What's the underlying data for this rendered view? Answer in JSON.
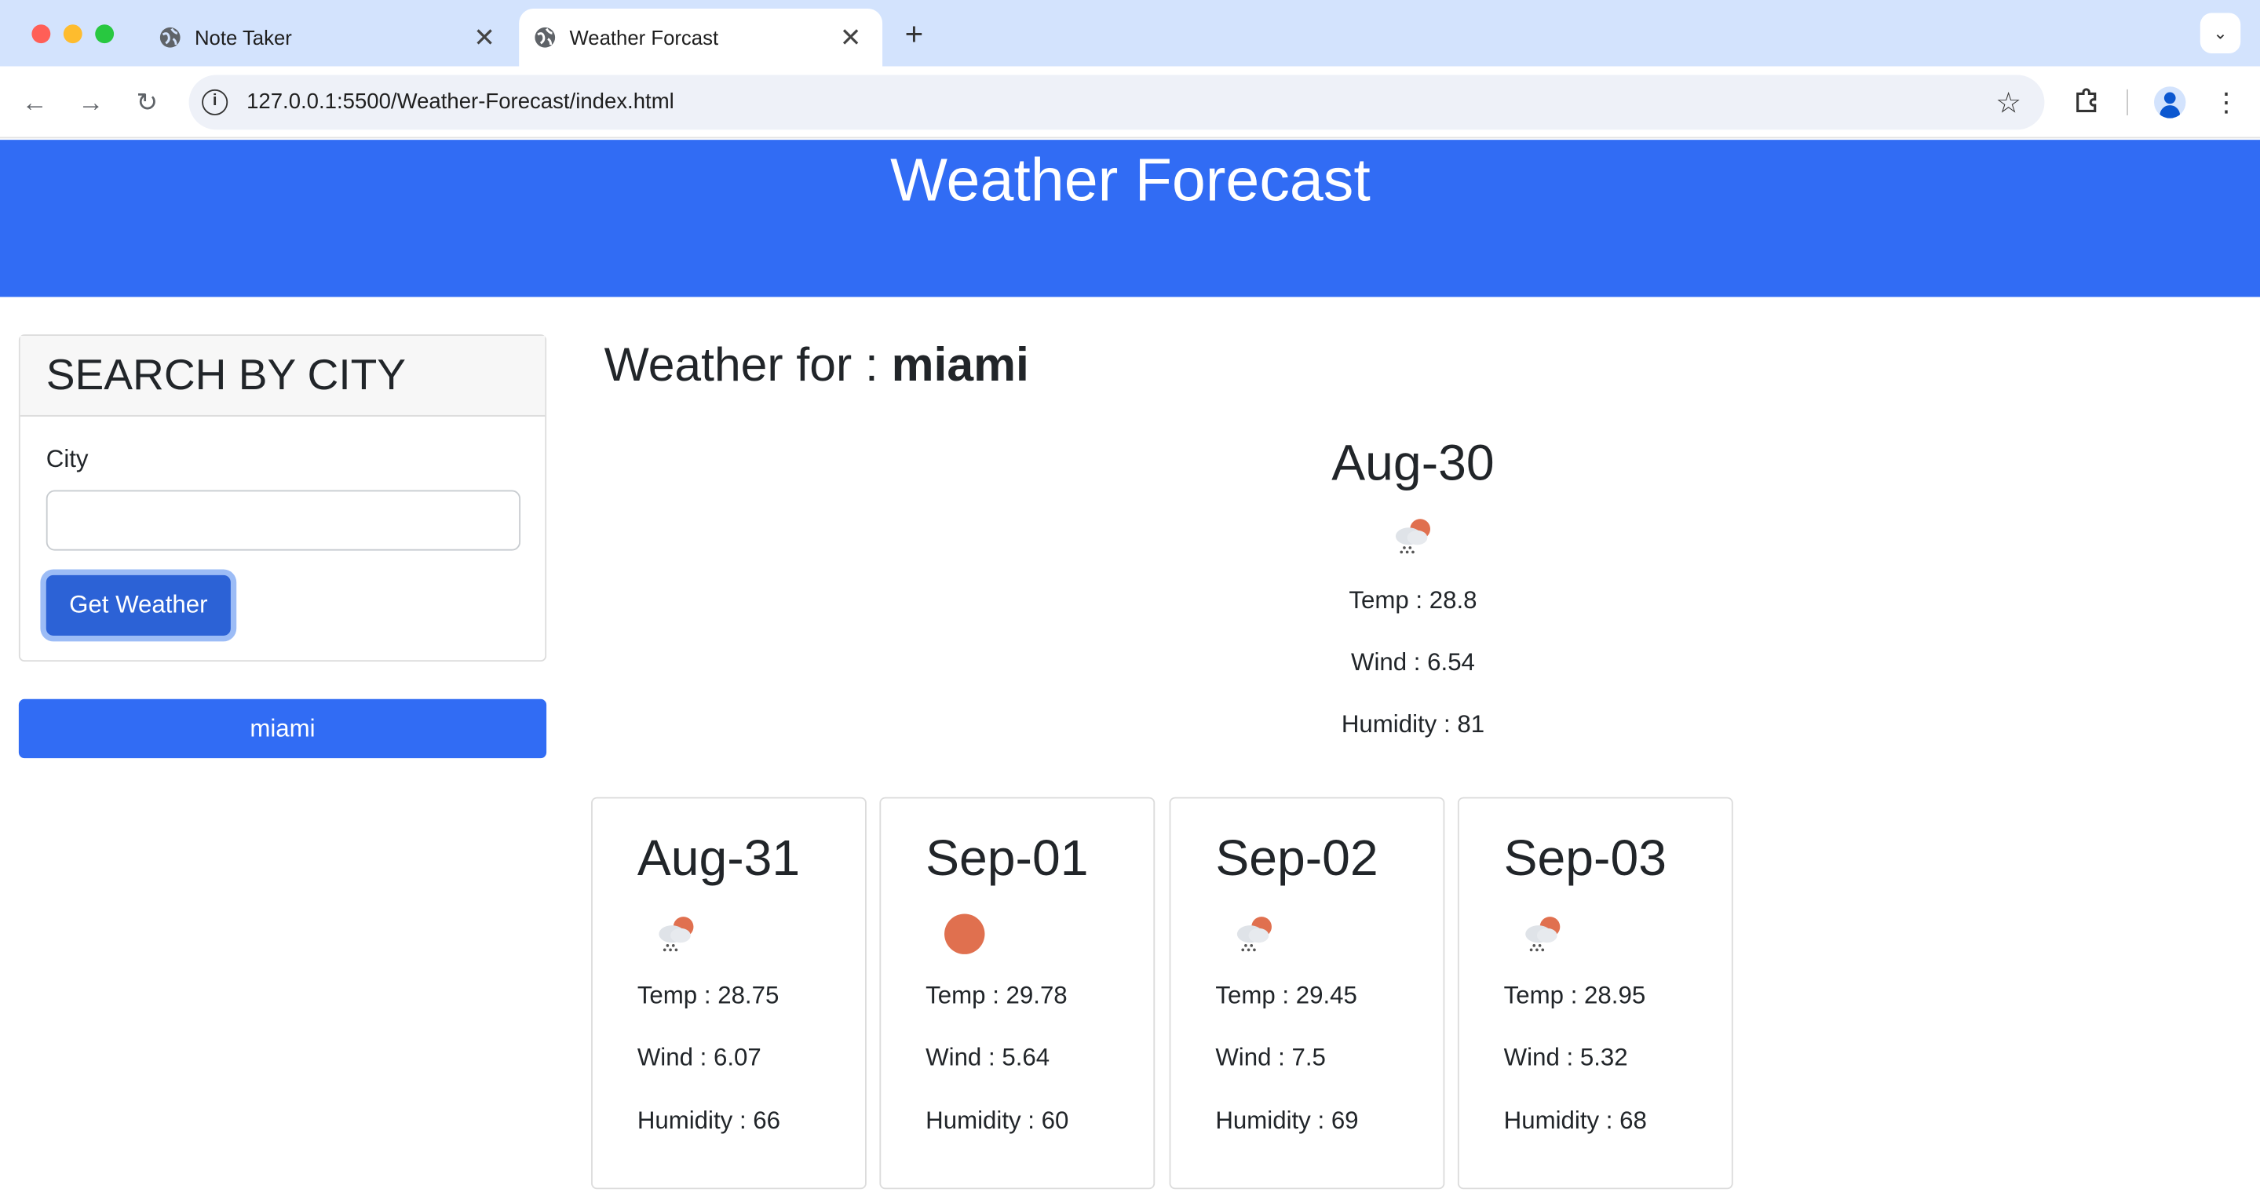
{
  "browser": {
    "tabs": [
      {
        "title": "Note Taker",
        "active": false
      },
      {
        "title": "Weather Forcast",
        "active": true
      }
    ],
    "url": "127.0.0.1:5500/Weather-Forecast/index.html"
  },
  "header": {
    "title": "Weather Forecast"
  },
  "search": {
    "heading": "SEARCH BY CITY",
    "city_label": "City",
    "city_value": "",
    "button_label": "Get Weather"
  },
  "history": [
    {
      "label": "miami"
    }
  ],
  "results": {
    "prefix": "Weather for : ",
    "city": "miami",
    "today": {
      "date": "Aug-30",
      "icon": "rain-cloud-sun-icon",
      "temp": "Temp : 28.8",
      "wind": "Wind : 6.54",
      "humidity": "Humidity : 81"
    },
    "forecast": [
      {
        "date": "Aug-31",
        "icon": "rain-cloud-sun-icon",
        "temp": "Temp : 28.75",
        "wind": "Wind : 6.07",
        "humidity": "Humidity : 66"
      },
      {
        "date": "Sep-01",
        "icon": "sun-icon",
        "temp": "Temp : 29.78",
        "wind": "Wind : 5.64",
        "humidity": "Humidity : 60"
      },
      {
        "date": "Sep-02",
        "icon": "rain-cloud-sun-icon",
        "temp": "Temp : 29.45",
        "wind": "Wind : 7.5",
        "humidity": "Humidity : 69"
      },
      {
        "date": "Sep-03",
        "icon": "rain-cloud-sun-icon",
        "temp": "Temp : 28.95",
        "wind": "Wind : 5.32",
        "humidity": "Humidity : 68"
      }
    ]
  },
  "colors": {
    "header_bg": "#316cf4",
    "button_bg": "#2c62d6",
    "sun": "#e0704f"
  }
}
